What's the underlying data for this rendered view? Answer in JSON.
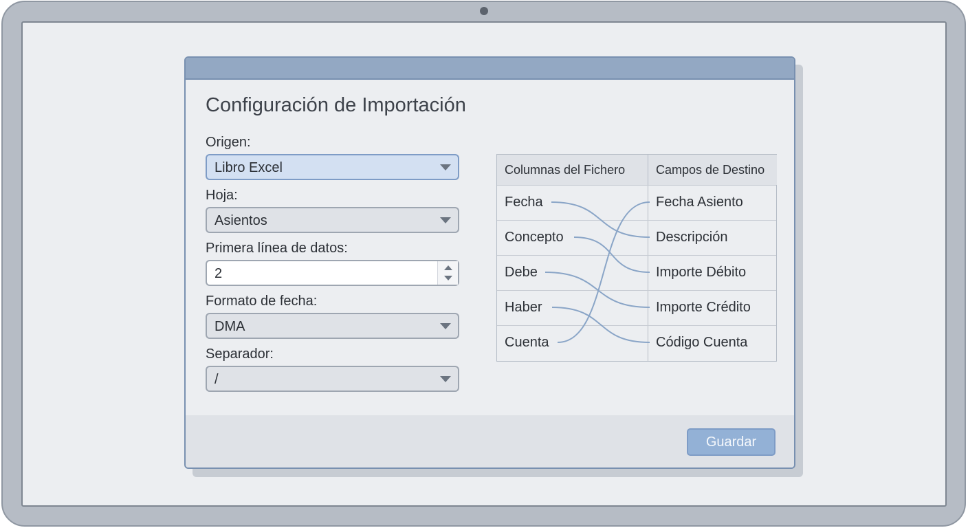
{
  "dialog": {
    "title": "Configuración de Importación",
    "save_label": "Guardar"
  },
  "fields": {
    "origen": {
      "label": "Origen:",
      "value": "Libro Excel"
    },
    "hoja": {
      "label": "Hoja:",
      "value": "Asientos"
    },
    "primera_linea": {
      "label": "Primera línea de datos:",
      "value": "2"
    },
    "formato_fecha": {
      "label": "Formato de fecha:",
      "value": "DMA"
    },
    "separador": {
      "label": "Separador:",
      "value": "/"
    }
  },
  "mapping": {
    "header_source": "Columnas del Fichero",
    "header_target": "Campos de Destino",
    "source": [
      "Fecha",
      "Concepto",
      "Debe",
      "Haber",
      "Cuenta"
    ],
    "target": [
      "Fecha Asiento",
      "Descripción",
      "Importe Débito",
      "Importe Crédito",
      "Código Cuenta"
    ],
    "links": [
      {
        "from": "Fecha",
        "to": "Descripción"
      },
      {
        "from": "Concepto",
        "to": "Importe Débito"
      },
      {
        "from": "Debe",
        "to": "Importe Crédito"
      },
      {
        "from": "Haber",
        "to": "Código Cuenta"
      },
      {
        "from": "Cuenta",
        "to": "Fecha Asiento"
      }
    ]
  },
  "colors": {
    "accent": "#93b1d6",
    "link_line": "#8aa5c7"
  }
}
